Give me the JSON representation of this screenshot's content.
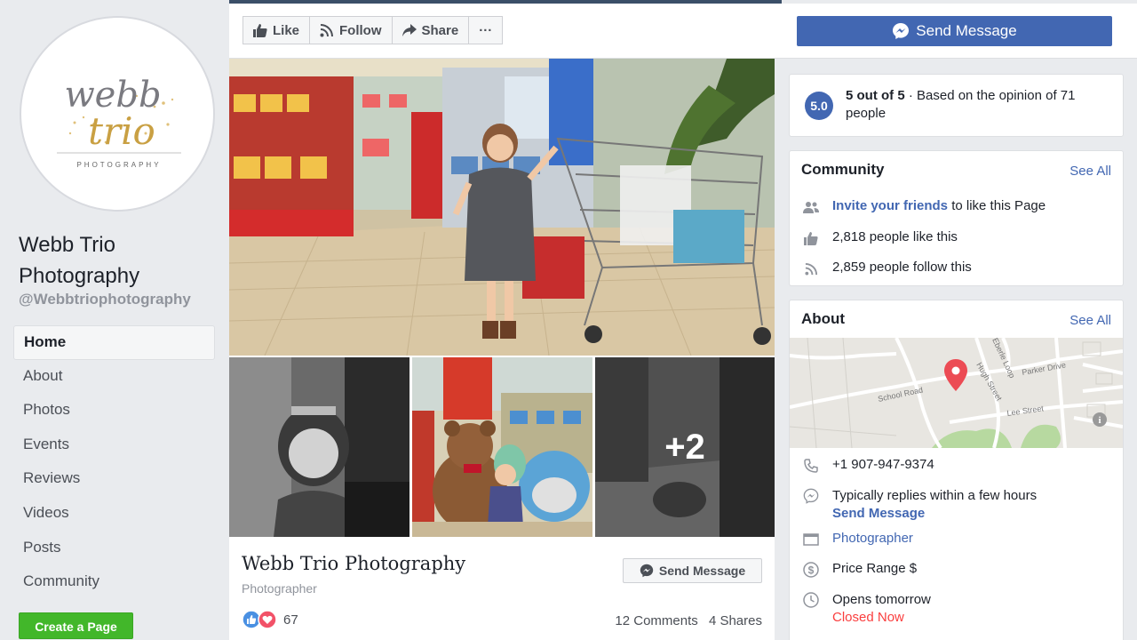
{
  "page": {
    "name": "Webb Trio Photography",
    "handle": "@Webbtriophotography",
    "logo_text": {
      "line1": "webb",
      "line2": "trio",
      "line3": "PHOTOGRAPHY"
    }
  },
  "nav": {
    "items": [
      {
        "label": "Home",
        "active": true
      },
      {
        "label": "About"
      },
      {
        "label": "Photos"
      },
      {
        "label": "Events"
      },
      {
        "label": "Reviews"
      },
      {
        "label": "Videos"
      },
      {
        "label": "Posts"
      },
      {
        "label": "Community"
      }
    ],
    "create_page_label": "Create a Page"
  },
  "toolbar": {
    "like_label": "Like",
    "follow_label": "Follow",
    "share_label": "Share",
    "more_label": "···",
    "send_message_label": "Send Message"
  },
  "post": {
    "title": "Webb Trio Photography",
    "subtitle": "Photographer",
    "send_message_label": "Send Message",
    "more_photos": "+2",
    "reaction_count": "67",
    "comments": "12 Comments",
    "shares": "4 Shares"
  },
  "rating": {
    "score": "5.0",
    "bold": "5 out of 5",
    "rest": " · Based on the opinion of 71 people"
  },
  "community": {
    "heading": "Community",
    "see_all": "See All",
    "invite_link": "Invite your friends",
    "invite_rest": " to like this Page",
    "likes": "2,818 people like this",
    "follows": "2,859 people follow this"
  },
  "about": {
    "heading": "About",
    "see_all": "See All",
    "map_labels": {
      "school_road": "School Road",
      "parker_drive": "Parker Drive",
      "lee_street": "Lee Street",
      "hugh_street": "Hugh Street",
      "eberle_loop": "Eberle Loop"
    },
    "phone": "+1 907-947-9374",
    "reply_text": "Typically replies within a few hours",
    "reply_link": "Send Message",
    "category": "Photographer",
    "price": "Price Range $",
    "hours": "Opens tomorrow",
    "status": "Closed Now"
  },
  "colors": {
    "brand": "#4267b2",
    "green": "#42b72a",
    "red": "#fa3e3e",
    "background": "#e9ebee"
  }
}
